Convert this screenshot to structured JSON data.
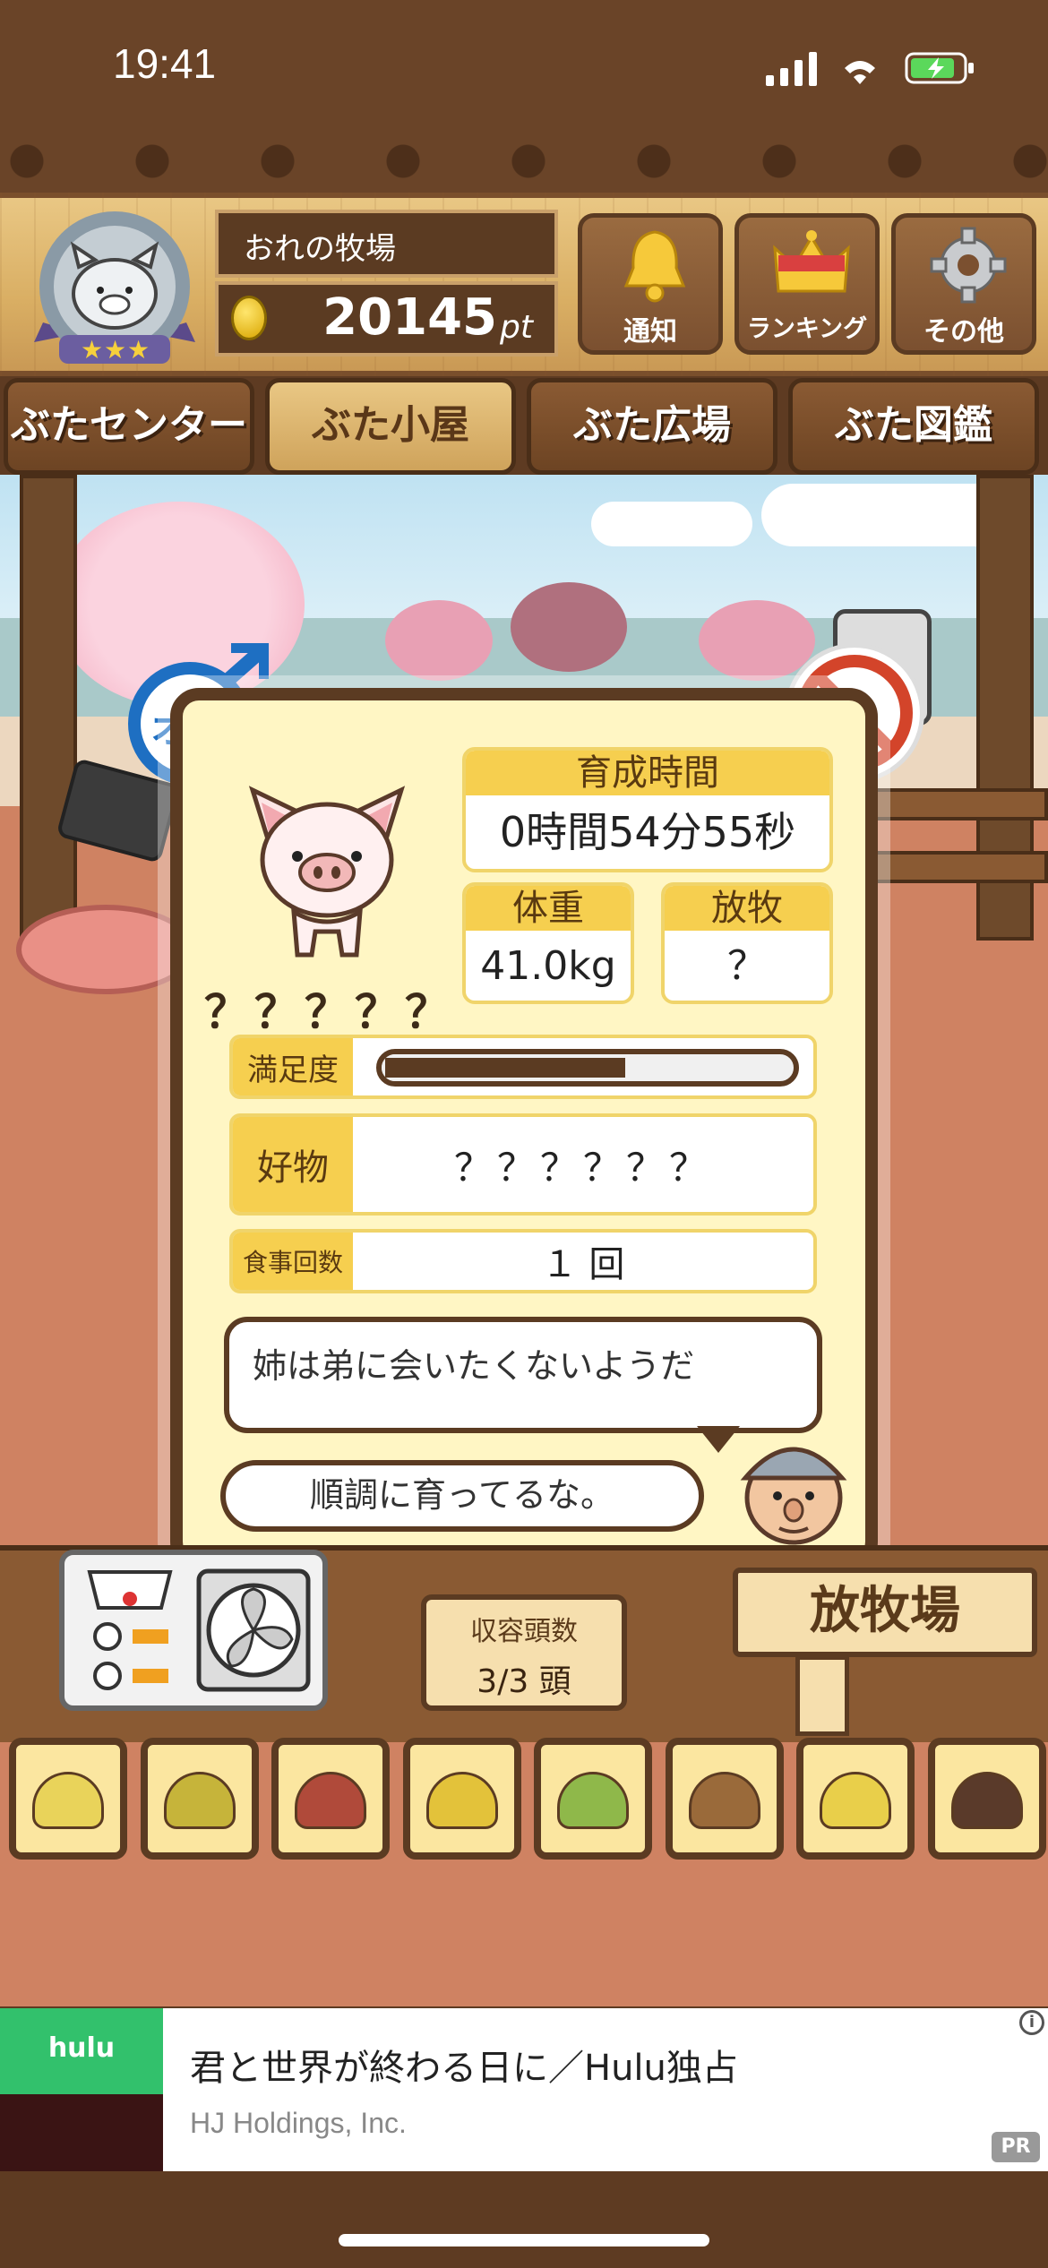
{
  "status_bar": {
    "time": "19:41"
  },
  "header": {
    "farm_name": "おれの牧場",
    "points": "20145",
    "points_unit": "pt",
    "rank_stars": 3,
    "buttons": [
      {
        "label": "通知",
        "icon": "bell-icon"
      },
      {
        "label": "ランキング",
        "icon": "crown-icon"
      },
      {
        "label": "その他",
        "icon": "gear-icon"
      }
    ]
  },
  "nav": {
    "tabs": [
      {
        "label": "ぶたセンター",
        "active": false
      },
      {
        "label": "ぶた小屋",
        "active": true
      },
      {
        "label": "ぶた広場",
        "active": false
      },
      {
        "label": "ぶた図鑑",
        "active": false
      }
    ]
  },
  "pig": {
    "gender": "オス",
    "name": "？？？？？",
    "raising_time_label": "育成時間",
    "raising_time": "0時間54分55秒",
    "weight_label": "体重",
    "weight": "41.0kg",
    "grazing_label": "放牧",
    "grazing": "？",
    "satisfaction_label": "満足度",
    "satisfaction_fraction": 0.6,
    "favorite_label": "好物",
    "favorite": "？？？？？？",
    "meal_count_label": "食事回数",
    "meal_count": "１ 回",
    "message": "姉は弟に会いたくないようだ",
    "farmer_comment": "順調に育ってるな。"
  },
  "capacity": {
    "label": "収容頭数",
    "value": "3/3 頭"
  },
  "pasture_sign": "放牧場",
  "food_items": [
    {
      "icon": "grain-pile-icon",
      "color": "#e9d35a"
    },
    {
      "icon": "mixed-grain-icon",
      "color": "#c6b43a"
    },
    {
      "icon": "sweet-potato-icon",
      "color": "#b04a3a"
    },
    {
      "icon": "corn-icon",
      "color": "#e3c23a"
    },
    {
      "icon": "beans-leaf-icon",
      "color": "#8fb84a"
    },
    {
      "icon": "acorn-icon",
      "color": "#9a6a3a"
    },
    {
      "icon": "soybean-plate-icon",
      "color": "#e9cf4a"
    },
    {
      "icon": "dark-ball-plate-icon",
      "color": "#5a3a2a"
    }
  ],
  "ad": {
    "thumb_brand": "hulu",
    "title": "君と世界が終わる日に／Hulu独占",
    "advertiser": "HJ Holdings, Inc.",
    "pr_label": "PR"
  }
}
